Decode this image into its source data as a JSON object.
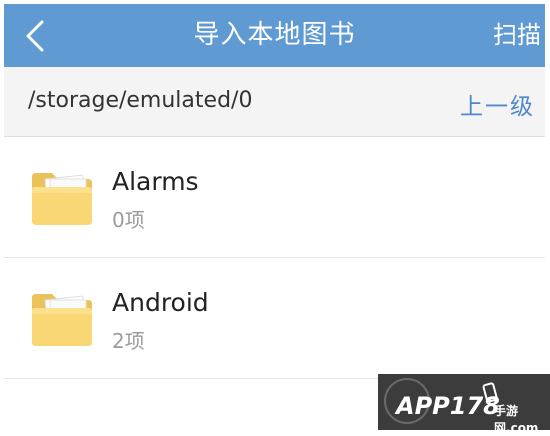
{
  "header": {
    "title": "导入本地图书",
    "scan_label": "扫描",
    "back_icon": "chevron-left-icon",
    "background_color": "#5f9ad3"
  },
  "path_bar": {
    "current_path": "/storage/emulated/0",
    "up_label": "上一级",
    "up_color": "#4f89c9"
  },
  "files": [
    {
      "name": "Alarms",
      "count": "0项",
      "icon": "folder-icon"
    },
    {
      "name": "Android",
      "count": "2项",
      "icon": "folder-icon"
    }
  ],
  "watermark": {
    "brand": "APP178",
    "sub": "手游网",
    "domain": ".com"
  }
}
